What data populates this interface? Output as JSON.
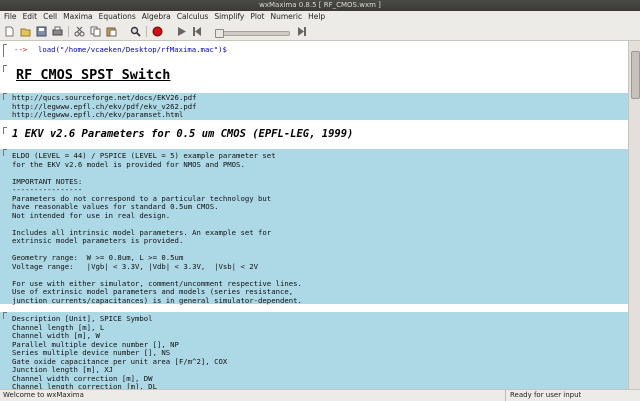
{
  "window": {
    "title": "wxMaxima 0.8.5  [ RF_CMOS.wxm ]"
  },
  "menu": [
    "File",
    "Edit",
    "Cell",
    "Maxima",
    "Equations",
    "Algebra",
    "Calculus",
    "Simplify",
    "Plot",
    "Numeric",
    "Help"
  ],
  "toolbar": {
    "icons": [
      "new-document-icon",
      "open-folder-icon",
      "save-icon",
      "print-icon",
      "cut-icon",
      "copy-icon",
      "paste-icon",
      "find-icon",
      "interrupt-icon",
      "play-icon",
      "step-back-icon",
      "step-forward-icon"
    ]
  },
  "cells": {
    "input": {
      "prompt": "-->",
      "code": "load(\"/home/vcaeken/Desktop/rfMaxima.mac\")$"
    },
    "title": "RF CMOS SPST Switch",
    "links": "http://qucs.sourceforge.net/docs/EKV26.pdf\nhttp://legwww.epfl.ch/ekv/pdf/ekv_v262.pdf\nhttp://legwww.epfl.ch/ekv/paramset.html",
    "section": "1 EKV v2.6 Parameters for 0.5 um CMOS (EPFL-LEG, 1999)",
    "notes": "ELDO (LEVEL = 44) / PSPICE (LEVEL = 5) example parameter set\nfor the EKV v2.6 model is provided for NMOS and PMOS.\n\nIMPORTANT NOTES:\n----------------\nParameters do not correspond to a particular technology but\nhave reasonable values for standard 0.5um CMOS.\nNot intended for use in real design.\n\nIncludes all intrinsic model parameters. An example set for\nextrinsic model parameters is provided.\n\nGeometry range:  W >= 0.8um, L >= 0.5um\nVoltage range:   |Vgb| < 3.3V, |Vdb| < 3.3V,  |Vsb| < 2V\n\nFor use with either simulator, comment/uncomment respective lines.\nUse of extrinsic model parameters and models (series resistance,\njunction currents/capacitances) is in general simulator-dependent.",
    "params": "Description [Unit], SPICE Symbol\nChannel length [m], L\nChannel width [m], W\nParallel multiple device number [], NP\nSeries multiple device number [], NS\nGate oxide capacitance per unit area [F/m^2], COX\nJunction length [m], XJ\nChannel width correction [m], DW\nChannel length correction [m], DL"
  },
  "status": {
    "left": "Welcome to wxMaxima",
    "right": "Ready for user input"
  },
  "colors": {
    "cell_bg": "#add8e6",
    "prompt": "#ff0000",
    "code": "#0000ff"
  }
}
